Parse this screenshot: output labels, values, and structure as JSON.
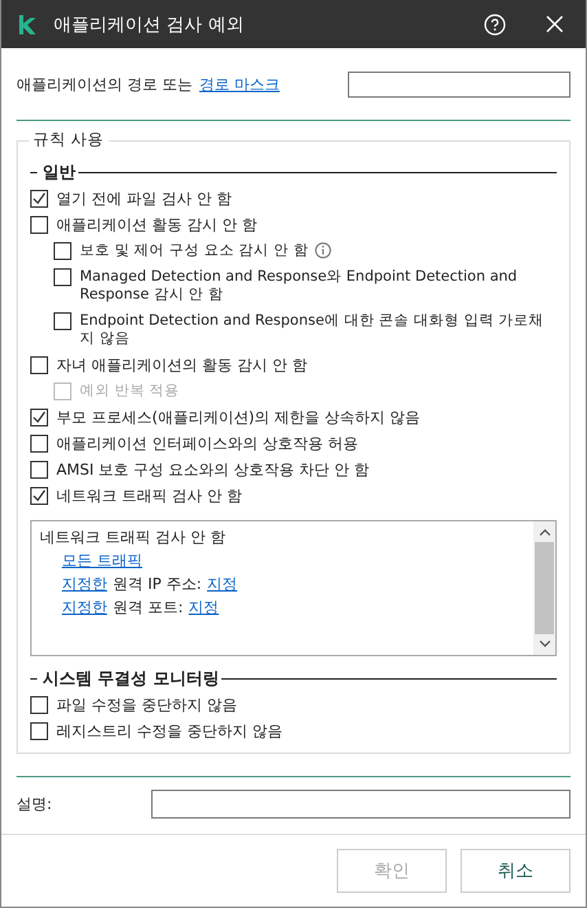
{
  "window": {
    "title": "애플리케이션 검사 예외"
  },
  "path": {
    "label": "애플리케이션의 경로 또는",
    "link": "경로 마스크"
  },
  "rules": {
    "title": "규칙 사용",
    "sections": [
      {
        "title": "일반",
        "items": [
          {
            "label": "열기 전에 파일 검사 안 함",
            "checked": true,
            "disabled": false
          },
          {
            "label": "애플리케이션 활동 감시 안 함",
            "checked": false,
            "disabled": false,
            "children": [
              {
                "label": "보호 및 제어 구성 요소 감시 안 함",
                "checked": false,
                "disabled": false,
                "info": true
              },
              {
                "label": "Managed Detection and Response와 Endpoint Detection and Response 감시 안 함",
                "checked": false,
                "disabled": false
              },
              {
                "label": "Endpoint Detection and Response에 대한 콘솔 대화형 입력 가로채지 않음",
                "checked": false,
                "disabled": false
              }
            ]
          },
          {
            "label": "자녀 애플리케이션의 활동 감시 안 함",
            "checked": false,
            "disabled": false,
            "children": [
              {
                "label": "예외 반복 적용",
                "checked": false,
                "disabled": true
              }
            ]
          },
          {
            "label": "부모 프로세스(애플리케이션)의 제한을 상속하지 않음",
            "checked": true,
            "disabled": false
          },
          {
            "label": "애플리케이션 인터페이스와의 상호작용 허용",
            "checked": false,
            "disabled": false
          },
          {
            "label": "AMSI 보호 구성 요소와의 상호작용 차단 안 함",
            "checked": false,
            "disabled": false
          },
          {
            "label": "네트워크 트래픽 검사 안 함",
            "checked": true,
            "disabled": false
          }
        ],
        "traffic": {
          "title": "네트워크 트래픽 검사 안 함",
          "lines": [
            [
              {
                "text": "모든 트래픽",
                "link": true
              }
            ],
            [
              {
                "text": "지정한",
                "link": true
              },
              {
                "text": "원격 IP 주소:",
                "link": false
              },
              {
                "text": "지정",
                "link": true
              }
            ],
            [
              {
                "text": "지정한",
                "link": true
              },
              {
                "text": "원격 포트:",
                "link": false
              },
              {
                "text": "지정",
                "link": true
              }
            ]
          ]
        }
      },
      {
        "title": "시스템 무결성 모니터링",
        "items": [
          {
            "label": "파일 수정을 중단하지 않음",
            "checked": false,
            "disabled": false
          },
          {
            "label": "레지스트리 수정을 중단하지 않음",
            "checked": false,
            "disabled": false
          }
        ]
      }
    ]
  },
  "description": {
    "label": "설명:"
  },
  "buttons": [
    {
      "label": "확인",
      "disabled": true
    },
    {
      "label": "취소",
      "disabled": false
    }
  ]
}
